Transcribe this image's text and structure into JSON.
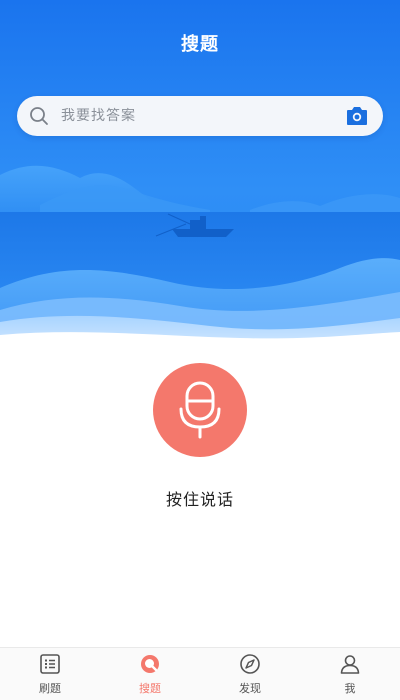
{
  "header": {
    "title": "搜题"
  },
  "search": {
    "placeholder": "我要找答案",
    "icon": "search-icon",
    "camera_icon": "camera-icon"
  },
  "voice": {
    "icon": "microphone-icon",
    "label": "按住说话"
  },
  "tabs": [
    {
      "label": "刷题",
      "icon": "list-icon",
      "active": false
    },
    {
      "label": "搜题",
      "icon": "search-circle-icon",
      "active": true
    },
    {
      "label": "发现",
      "icon": "compass-icon",
      "active": false
    },
    {
      "label": "我",
      "icon": "user-icon",
      "active": false
    }
  ],
  "colors": {
    "hero_blue": "#1f7ef0",
    "accent": "#f4786c",
    "camera_blue": "#1a6fdf",
    "tab_inactive": "#555555"
  }
}
